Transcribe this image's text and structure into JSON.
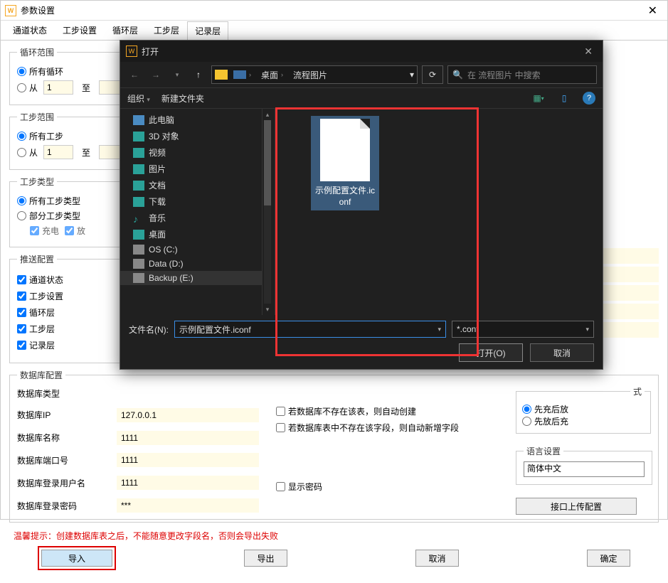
{
  "main": {
    "title": "参数设置",
    "tabs": [
      "通道状态",
      "工步设置",
      "循环层",
      "工步层",
      "记录层"
    ],
    "active_tab": 4,
    "loop_range": {
      "legend": "循环范围",
      "opt_all": "所有循环",
      "opt_from": "从",
      "from_val": "1",
      "to_label": "至"
    },
    "step_range": {
      "legend": "工步范围",
      "opt_all": "所有工步",
      "opt_from": "从",
      "from_val": "1",
      "to_label": "至"
    },
    "step_type": {
      "legend": "工步类型",
      "opt_all": "所有工步类型",
      "opt_part": "部分工步类型",
      "charge_label": "充电",
      "discharge_label": "放"
    },
    "push": {
      "legend": "推送配置",
      "items": [
        "通道状态",
        "工步设置",
        "循环层",
        "工步层",
        "记录层"
      ]
    },
    "db": {
      "legend": "数据库配置",
      "labels": {
        "type": "数据库类型",
        "ip": "数据库IP",
        "name": "数据库名称",
        "port": "数据库端口号",
        "user": "数据库登录用户名",
        "pwd": "数据库登录密码"
      },
      "values": {
        "ip": "127.0.0.1",
        "name": "1111",
        "port": "1111",
        "user": "1111",
        "pwd": "***"
      },
      "auto_create_table": "若数据库不存在该表，则自动创建",
      "auto_add_field": "若数据库表中不存在该字段，则自动新增字段",
      "show_pwd": "显示密码"
    },
    "file_mode": {
      "legend_suffix": "式",
      "opt1": "先充后放",
      "opt2": "先放后充"
    },
    "lang": {
      "legend": "语言设置",
      "value": "简体中文"
    },
    "upload_btn": "接口上传配置",
    "warning": "温馨提示：创建数据库表之后，不能随意更改字段名，否则会导出失败",
    "buttons": {
      "import": "导入",
      "export": "导出",
      "cancel": "取消",
      "ok": "确定"
    }
  },
  "dialog": {
    "title": "打开",
    "path_segments": [
      "",
      "桌面",
      "流程图片"
    ],
    "search_placeholder": "在 流程图片 中搜索",
    "toolbar": {
      "organize": "组织",
      "new_folder": "新建文件夹"
    },
    "tree": [
      {
        "label": "此电脑",
        "icon": "ic-pc"
      },
      {
        "label": "3D 对象",
        "icon": "ic-3d"
      },
      {
        "label": "视频",
        "icon": "ic-video"
      },
      {
        "label": "图片",
        "icon": "ic-pic"
      },
      {
        "label": "文档",
        "icon": "ic-doc"
      },
      {
        "label": "下载",
        "icon": "ic-dl"
      },
      {
        "label": "音乐",
        "icon": "ic-music"
      },
      {
        "label": "桌面",
        "icon": "ic-desktop"
      },
      {
        "label": "OS (C:)",
        "icon": "ic-drive"
      },
      {
        "label": "Data (D:)",
        "icon": "ic-drive"
      },
      {
        "label": "Backup (E:)",
        "icon": "ic-drive",
        "sel": true
      }
    ],
    "file": {
      "name_lines": "示例配置文件.iconf"
    },
    "filename_label": "文件名(N):",
    "filename_value": "示例配置文件.iconf",
    "filetype_value": "*.conf",
    "open_btn": "打开(O)",
    "cancel_btn": "取消"
  }
}
